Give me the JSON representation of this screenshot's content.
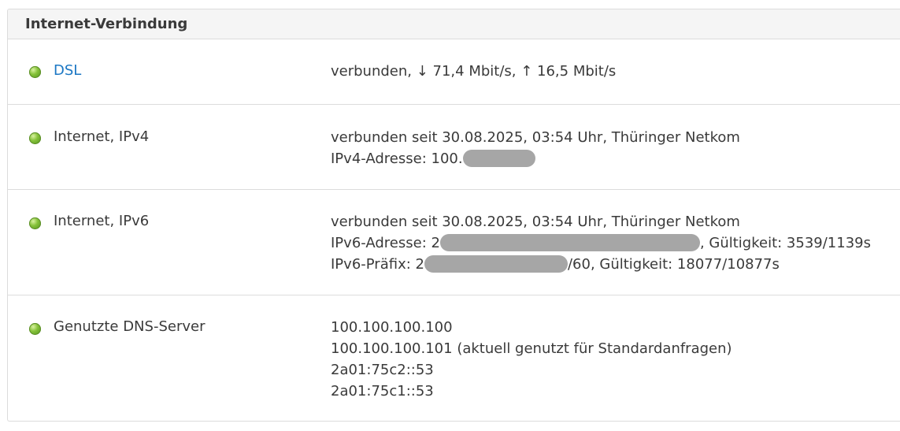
{
  "panel": {
    "title": "Internet-Verbindung"
  },
  "rows": {
    "dsl": {
      "name": "DSL",
      "status_line": "verbunden, ↓ 71,4 Mbit/s, ↑ 16,5 Mbit/s"
    },
    "ipv4": {
      "name": "Internet, IPv4",
      "status_line": "verbunden seit 30.08.2025, 03:54 Uhr, Thüringer Netkom",
      "address_label": "IPv4-Adresse: 100."
    },
    "ipv6": {
      "name": "Internet, IPv6",
      "status_line": "verbunden seit 30.08.2025, 03:54 Uhr, Thüringer Netkom",
      "address_label": "IPv6-Adresse: 2",
      "address_suffix": ", Gültigkeit: 3539/1139s",
      "prefix_label": "IPv6-Präfix: 2",
      "prefix_suffix": "/60, Gültigkeit: 18077/10877s"
    },
    "dns": {
      "name": "Genutzte DNS-Server",
      "servers": [
        "100.100.100.100",
        "100.100.100.101 (aktuell genutzt für Standardanfragen)",
        "2a01:75c2::53",
        "2a01:75c1::53"
      ]
    }
  },
  "colors": {
    "status_ok": "#86c23a",
    "link": "#1b77c4",
    "header_bg": "#f5f5f5",
    "redaction": "#a6a6a6"
  },
  "icons": {
    "status": "green-status-led-icon"
  }
}
